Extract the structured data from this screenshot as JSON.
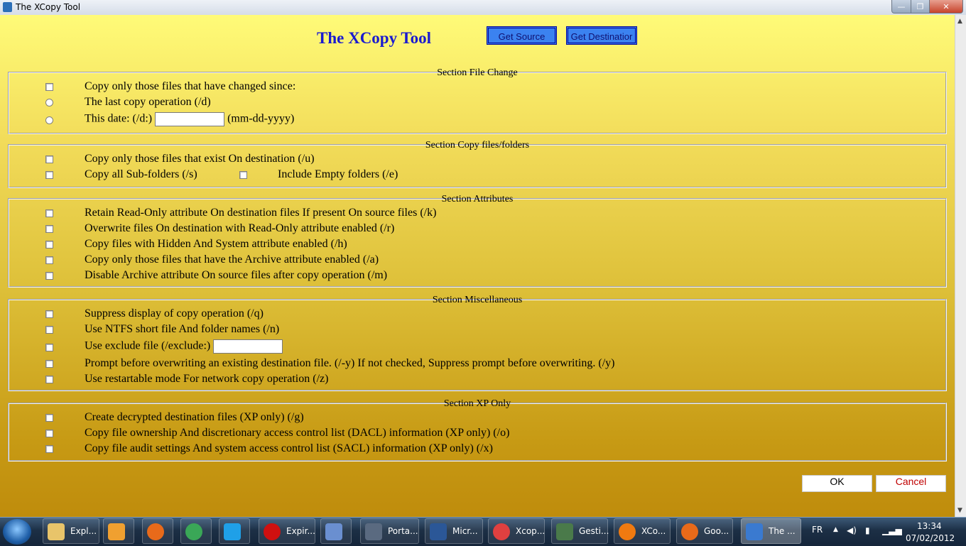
{
  "window": {
    "title": "The XCopy Tool",
    "controls": {
      "minimize": "—",
      "maximize": "❐",
      "close": "✕"
    }
  },
  "header": {
    "title": "The XCopy Tool",
    "get_source": "Get Source",
    "get_destination": "Get Destinatior"
  },
  "sections": {
    "file_change": {
      "legend": "Section File Change",
      "opt_changed": "Copy only those files that have changed since:",
      "opt_last": "The last copy operation (/d)",
      "opt_date_prefix": "This date: (/d:)",
      "opt_date_suffix": "(mm-dd-yyyy)",
      "date_value": ""
    },
    "copy_files": {
      "legend": "Section Copy files/folders",
      "opt_exist": "Copy only those files that exist On destination (/u)",
      "opt_sub": "Copy all Sub-folders (/s)",
      "opt_empty": "Include Empty folders (/e)"
    },
    "attributes": {
      "legend": "Section Attributes",
      "items": [
        "Retain Read-Only attribute On destination files If present On source files (/k)",
        "Overwrite files On destination with Read-Only attribute enabled (/r)",
        "Copy files with Hidden And System attribute enabled (/h)",
        "Copy only those files that have the Archive attribute enabled (/a)",
        "Disable Archive attribute On source files after copy operation (/m)"
      ]
    },
    "misc": {
      "legend": "Section Miscellaneous",
      "opt_suppress": "Suppress display of copy operation (/q)",
      "opt_ntfs": "Use NTFS short file And folder names (/n)",
      "opt_exclude": "Use exclude file (/exclude:)",
      "exclude_value": "",
      "opt_prompt": "Prompt before overwriting an existing destination file. (/-y) If not checked, Suppress prompt before overwriting. (/y)",
      "opt_restart": "Use restartable mode For network copy operation (/z)"
    },
    "xp_only": {
      "legend": "Section XP Only",
      "items": [
        "Create decrypted destination files (XP only) (/g)",
        "Copy file ownership And discretionary access control list (DACL) information (XP only) (/o)",
        "Copy file audit settings And system access control list (SACL) information (XP only) (/x)"
      ]
    }
  },
  "buttons": {
    "ok": "OK",
    "cancel": "Cancel"
  },
  "colors": {
    "title_blue": "#1a1ad0",
    "button_blue": "#3b82f0",
    "cancel_red": "#c00000",
    "bg_top": "#fffb78",
    "bg_bottom": "#bf8c0c"
  },
  "taskbar": {
    "items": [
      {
        "label": "Expl...",
        "icon": "folder-icon",
        "color": "#e8c46a"
      },
      {
        "label": "",
        "icon": "media-player-icon",
        "color": "#f0a030"
      },
      {
        "label": "",
        "icon": "firefox-icon",
        "color": "#e86a1a"
      },
      {
        "label": "",
        "icon": "chrome-icon",
        "color": "#3aa757"
      },
      {
        "label": "",
        "icon": "skype-icon",
        "color": "#1fa0e8"
      },
      {
        "label": "Expir...",
        "icon": "opera-icon",
        "color": "#d01010"
      },
      {
        "label": "",
        "icon": "tool-icon",
        "color": "#6a8fd0"
      },
      {
        "label": "Porta...",
        "icon": "steam-icon",
        "color": "#5a6a80"
      },
      {
        "label": "Micr...",
        "icon": "word-icon",
        "color": "#2b5797"
      },
      {
        "label": "Xcop...",
        "icon": "ball-icon",
        "color": "#e04040"
      },
      {
        "label": "Gesti...",
        "icon": "monitor-icon",
        "color": "#4a7a4a"
      },
      {
        "label": "XCo...",
        "icon": "orb-icon",
        "color": "#f07a10"
      },
      {
        "label": "Goo...",
        "icon": "firefox-icon",
        "color": "#e86a1a"
      },
      {
        "label": "The ...",
        "icon": "app-icon",
        "color": "#3a7ad0"
      }
    ],
    "lang": "FR",
    "time": "13:34",
    "date": "07/02/2012"
  }
}
